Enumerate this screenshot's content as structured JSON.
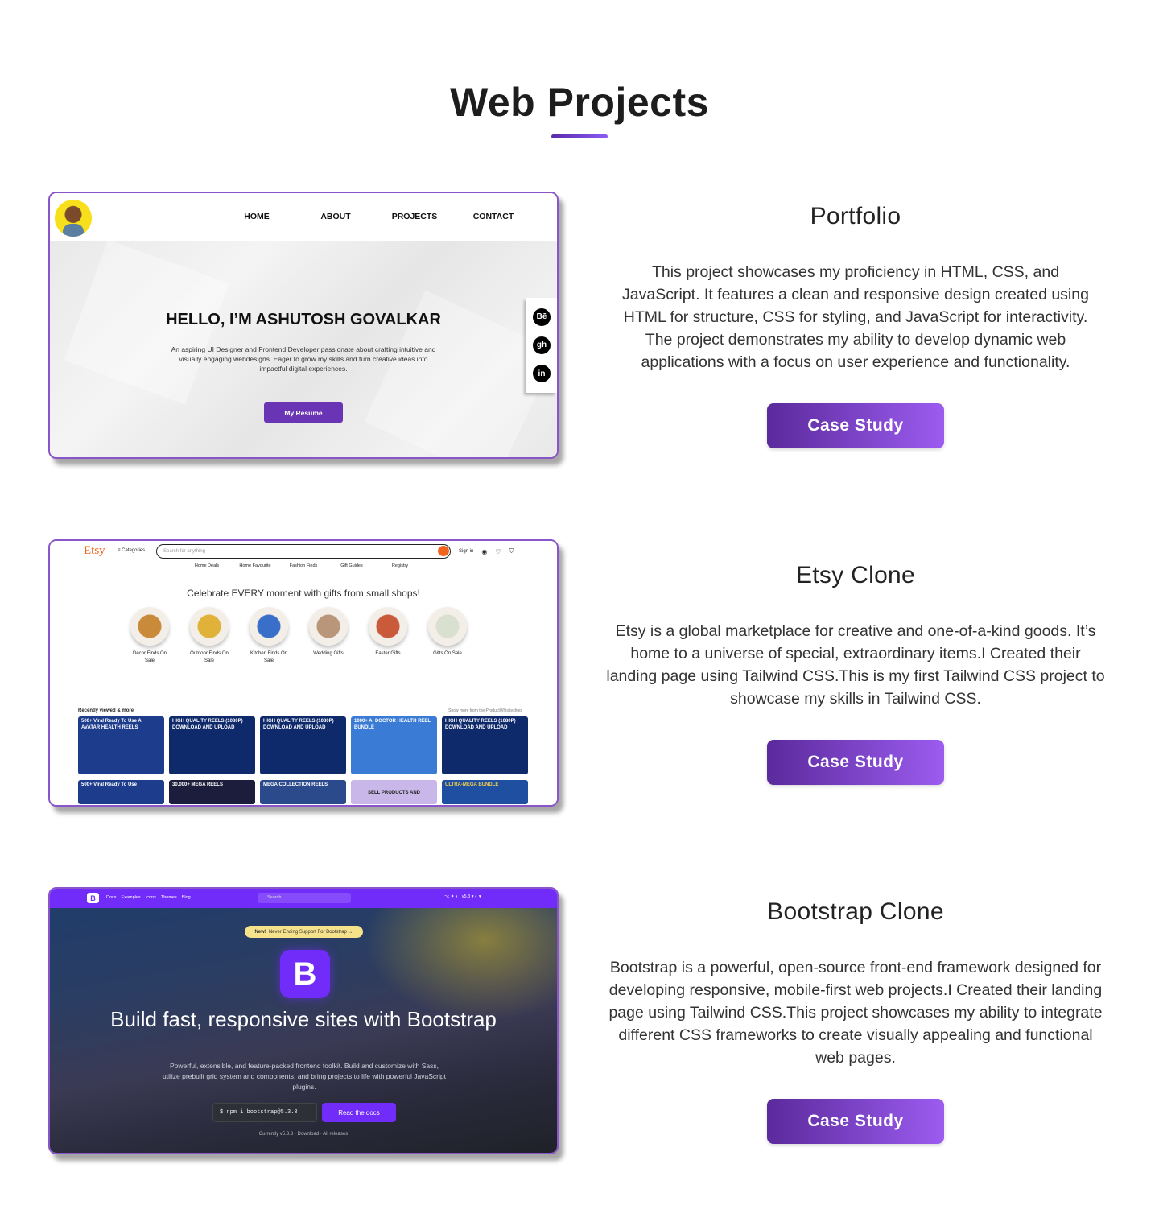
{
  "page": {
    "title": "Web Projects",
    "accent_gradient": [
      "#5a2aa8",
      "#8b5cf6"
    ]
  },
  "projects": [
    {
      "title": "Portfolio",
      "description": "This project showcases my proficiency in HTML, CSS, and JavaScript. It features a clean and responsive design created using HTML for structure, CSS for styling, and JavaScript for interactivity. The project demonstrates my ability to develop dynamic web applications with a focus on user experience and functionality.",
      "button_label": "Case Study"
    },
    {
      "title": "Etsy Clone",
      "description": "Etsy is a global marketplace for creative and one-of-a-kind goods. It’s home to a universe of special, extraordinary items.I Created their landing page using Tailwind CSS.This is my first Tailwind CSS project to showcase my skills in Tailwind CSS.",
      "button_label": "Case Study"
    },
    {
      "title": "Bootstrap Clone",
      "description": "Bootstrap is a powerful, open-source front-end framework designed for developing responsive, mobile-first web projects.I Created their landing page using Tailwind CSS.This project showcases my ability to integrate different CSS frameworks to create visually appealing and functional web pages.",
      "button_label": "Case Study"
    }
  ],
  "portfolio_shot": {
    "nav": [
      "HOME",
      "ABOUT",
      "PROJECTS",
      "CONTACT"
    ],
    "heading": "HELLO, I’M ASHUTOSH GOVALKAR",
    "intro": "An aspiring UI Designer and Frontend Developer passionate about crafting intuitive and visually engaging webdesigns. Eager to grow my skills and turn creative ideas into impactful digital experiences.",
    "resume_label": "My Resume",
    "social": [
      "Bē",
      "gh",
      "in"
    ],
    "social_icons": [
      "behance-icon",
      "github-icon",
      "linkedin-icon"
    ]
  },
  "etsy_shot": {
    "logo": "Etsy",
    "categories": "≡ Categories",
    "search_placeholder": "Search for anything",
    "sign_in": "Sign in",
    "subnav": [
      "Home Deals",
      "Home Favourite",
      "Fashion Finds",
      "Gift Guides",
      "Registry"
    ],
    "tagline": "Celebrate EVERY moment with gifts from small shops!",
    "circles": [
      {
        "label": "Decor Finds On Sale",
        "color": "#c98a3a"
      },
      {
        "label": "Outdoor Finds On Sale",
        "color": "#e0b23a"
      },
      {
        "label": "Kitchen Finds On Sale",
        "color": "#3a6fc9"
      },
      {
        "label": "Wedding Gifts",
        "color": "#b9967a"
      },
      {
        "label": "Easter Gifts",
        "color": "#c95a3a"
      },
      {
        "label": "Gifts On Sale",
        "color": "#d9e0d0"
      }
    ],
    "recent_label": "Recently viewed & more",
    "more_label": "Show more from the ProductWhistleshop",
    "tiles": [
      {
        "text": "500+ Viral Ready To Use AI AVATAR HEALTH REELS",
        "color": "#1e3c8c"
      },
      {
        "text": "HIGH QUALITY REELS (1080P) DOWNLOAD AND UPLOAD",
        "color": "#0f2a6b"
      },
      {
        "text": "HIGH QUALITY REELS (1080P) DOWNLOAD AND UPLOAD",
        "color": "#0f2a6b"
      },
      {
        "text": "1000+ AI DOCTOR HEALTH REEL BUNDLE",
        "color": "#3a7bd5"
      },
      {
        "text": "HIGH QUALITY REELS (1080P) DOWNLOAD AND UPLOAD",
        "color": "#0f2a6b"
      },
      {
        "text": "500+ Viral Ready To Use",
        "color": "#1e3c8c"
      },
      {
        "text": "30,000+ MEGA REELS",
        "color": "#1c1c3c"
      },
      {
        "text": "MEGA COLLECTION REELS",
        "color": "#2a4a8c"
      },
      {
        "text": "SELL PRODUCTS AND",
        "color": "#c8b7e8"
      },
      {
        "text": "ULTRA-MEGA BUNDLE",
        "color": "#1e4fa0"
      }
    ]
  },
  "bootstrap_shot": {
    "logo": "B",
    "links": [
      "Docs",
      "Examples",
      "Icons",
      "Themes",
      "Blog"
    ],
    "search": "Search",
    "nav_right": "⌥ ✦ ◐  |  v5.3 ▾   ◐ ▾",
    "badge_new": "New!",
    "badge_text": "Never Ending Support For Bootstrap →",
    "big_logo": "B",
    "heading": "Build fast, responsive sites with Bootstrap",
    "description": "Powerful, extensible, and feature-packed frontend toolkit. Build and customize with Sass, utilize prebuilt grid system and components, and bring projects to life with powerful JavaScript plugins.",
    "npm": "$  npm i bootstrap@5.3.3",
    "docs_label": "Read the docs",
    "current": "Currently v5.3.3 · Download · All releases"
  }
}
